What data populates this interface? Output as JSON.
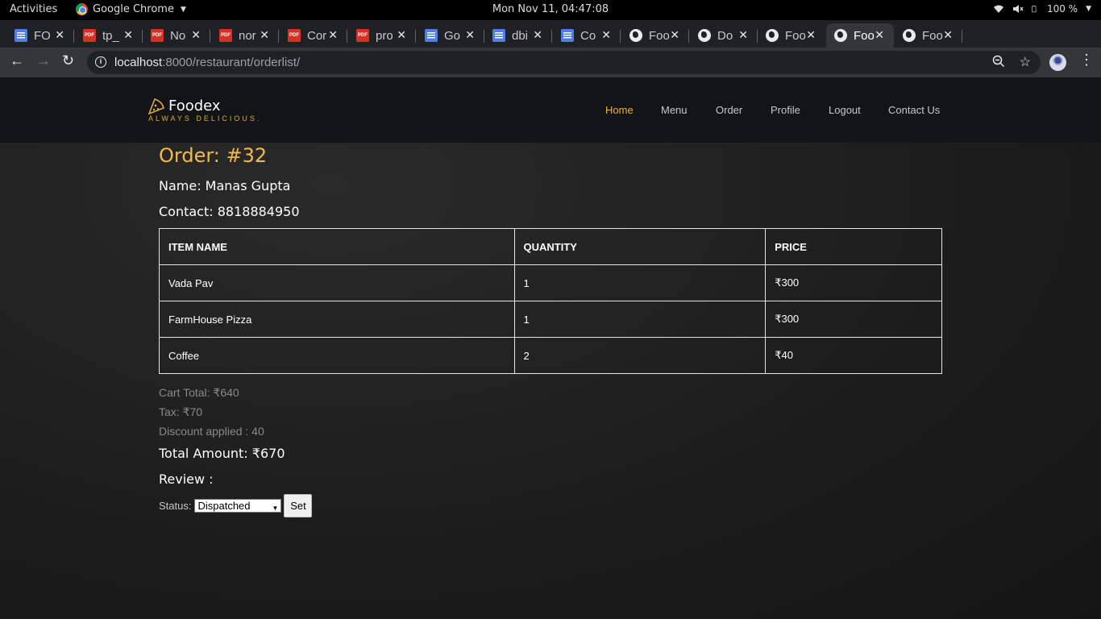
{
  "system_bar": {
    "activities": "Activities",
    "app_name": "Google Chrome",
    "clock": "Mon Nov 11, 04:47:08",
    "battery": "100 %"
  },
  "browser": {
    "tabs": [
      {
        "icon": "doc-icon",
        "title": "FO"
      },
      {
        "icon": "pdf-icon",
        "title": "tp_"
      },
      {
        "icon": "pdf-icon",
        "title": "No"
      },
      {
        "icon": "pdf-icon",
        "title": "nor"
      },
      {
        "icon": "pdf-icon",
        "title": "Cor"
      },
      {
        "icon": "pdf-icon",
        "title": "pro"
      },
      {
        "icon": "doc-icon",
        "title": "Go"
      },
      {
        "icon": "doc-icon",
        "title": "dbi"
      },
      {
        "icon": "doc-icon",
        "title": "Co"
      },
      {
        "icon": "globe-icon",
        "title": "Foo"
      },
      {
        "icon": "globe-icon",
        "title": "Do"
      },
      {
        "icon": "globe-icon",
        "title": "Foo"
      },
      {
        "icon": "globe-icon",
        "title": "Foo",
        "active": true
      },
      {
        "icon": "globe-icon",
        "title": "Foo"
      }
    ],
    "url_host": "localhost",
    "url_rest": ":8000/restaurant/orderlist/"
  },
  "site": {
    "brand": "Foodex",
    "tagline": "ALWAYS DELICIOUS.",
    "nav": [
      "Home",
      "Menu",
      "Order",
      "Profile",
      "Logout",
      "Contact Us"
    ],
    "active_nav": "Home",
    "accent_color": "#f5b94a"
  },
  "order": {
    "title": "Order: #32",
    "name_line": "Name: Manas Gupta",
    "contact_line": "Contact: 8818884950",
    "columns": [
      "ITEM NAME",
      "QUANTITY",
      "PRICE"
    ],
    "rows": [
      [
        "Vada Pav",
        "1",
        "₹300"
      ],
      [
        "FarmHouse Pizza",
        "1",
        "₹300"
      ],
      [
        "Coffee",
        "2",
        "₹40"
      ]
    ],
    "cart_total": "Cart Total: ₹640",
    "tax": "Tax: ₹70",
    "discount": "Discount applied : 40",
    "total_amount": "Total Amount: ₹670",
    "review": "Review :",
    "status_label": "Status:",
    "status_value": "Dispatched",
    "set_label": "Set"
  }
}
